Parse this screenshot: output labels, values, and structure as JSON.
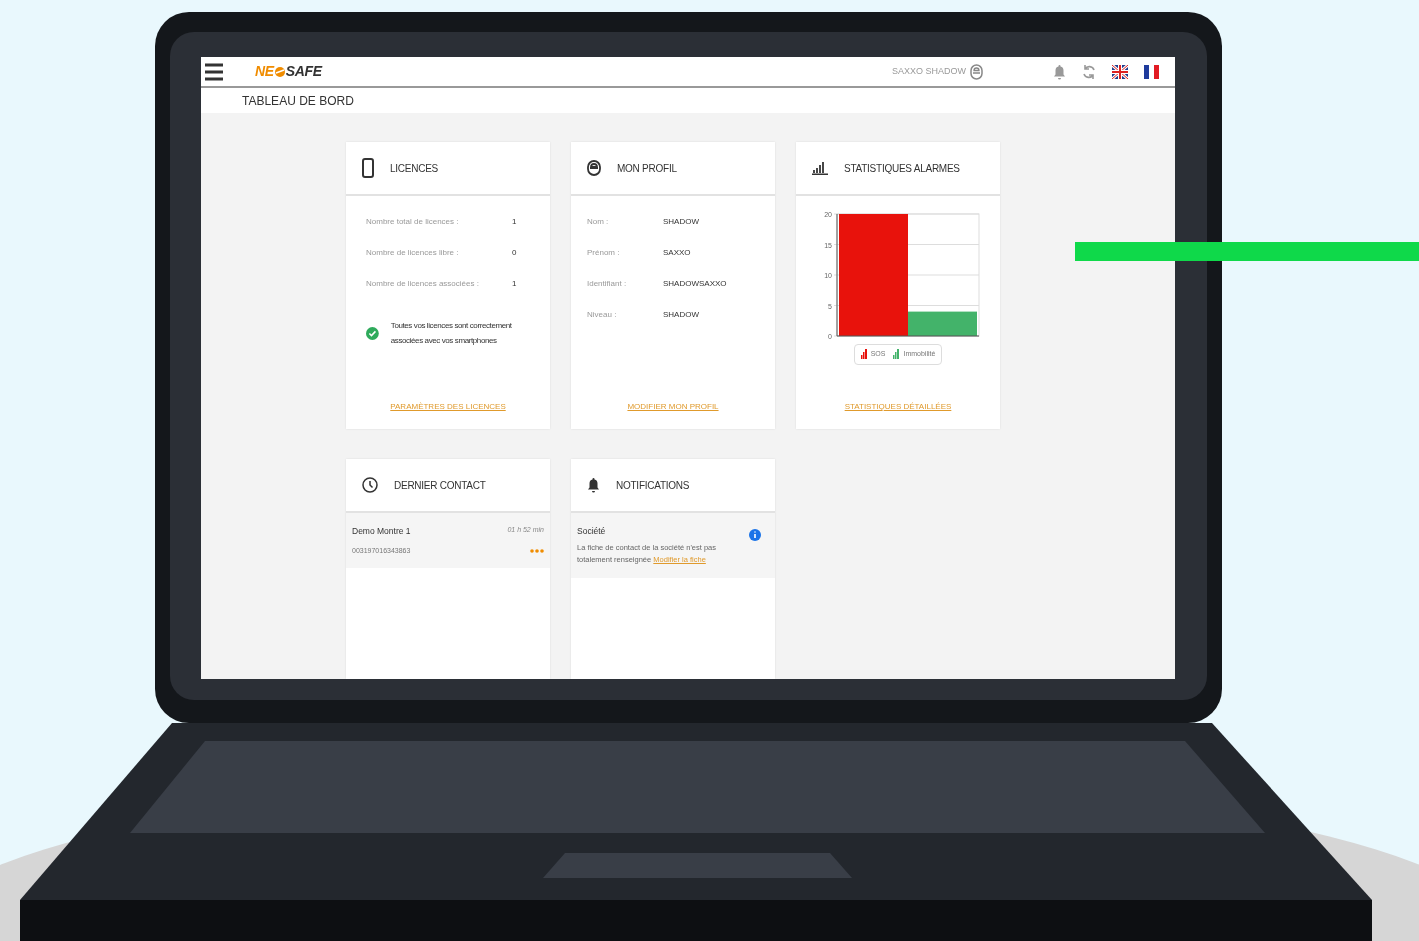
{
  "header": {
    "logo": {
      "part1": "NE",
      "part2": "SAFE"
    },
    "user": "SAXXO SHADOW"
  },
  "page_title": "TABLEAU DE BORD",
  "licences": {
    "title": "LICENCES",
    "rows": [
      {
        "label": "Nombre total de licences :",
        "value": "1"
      },
      {
        "label": "Nombre de licences libre :",
        "value": "0"
      },
      {
        "label": "Nombre de licences associées :",
        "value": "1"
      }
    ],
    "status_message": "Toutes vos licences sont correctement associées avec vos smartphones",
    "link": "PARAMÈTRES DES LICENCES"
  },
  "profile": {
    "title": "MON PROFIL",
    "rows": [
      {
        "label": "Nom :",
        "value": "SHADOW"
      },
      {
        "label": "Prénom :",
        "value": "SAXXO"
      },
      {
        "label": "Identifiant :",
        "value": "SHADOWSAXXO"
      },
      {
        "label": "Niveau :",
        "value": "SHADOW"
      }
    ],
    "link": "MODIFIER MON PROFIL"
  },
  "stats": {
    "title": "STATISTIQUES ALARMES",
    "chart_data": {
      "type": "bar",
      "grid": true,
      "ylim": [
        0,
        20
      ],
      "yticks": [
        0,
        5,
        10,
        15,
        20
      ],
      "series": [
        {
          "name": "SOS",
          "color": "#e8120c",
          "values": [
            20
          ]
        },
        {
          "name": "Immobilité",
          "color": "#43b36a",
          "values": [
            4
          ]
        }
      ]
    },
    "link": "STATISTIQUES DÉTAILLÉES"
  },
  "last_contact": {
    "title": "DERNIER CONTACT",
    "items": [
      {
        "name": "Demo Montre 1",
        "time": "01 h 52 min",
        "number": "003197016343863"
      }
    ]
  },
  "notifications": {
    "title": "NOTIFICATIONS",
    "items": [
      {
        "title": "Société",
        "text": "La fiche de contact de la société n'est pas totalement renseignée",
        "link": "Modifier la fiche"
      }
    ]
  }
}
